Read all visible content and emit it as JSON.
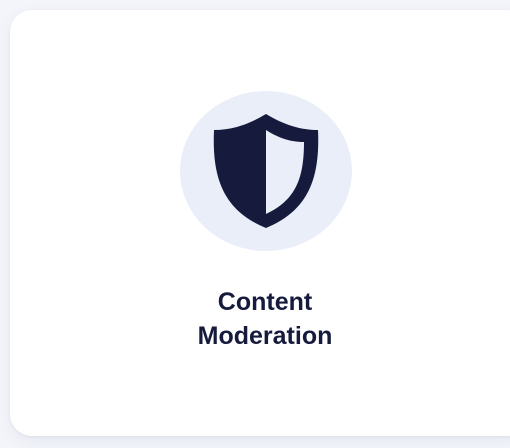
{
  "card": {
    "title_line1": "Content",
    "title_line2": "Moderation",
    "icon": "shield-icon"
  },
  "colors": {
    "background": "#f3f5fb",
    "card": "#ffffff",
    "icon_circle": "#e9eef8",
    "icon_fill": "#161b3d",
    "text": "#161b3d"
  }
}
